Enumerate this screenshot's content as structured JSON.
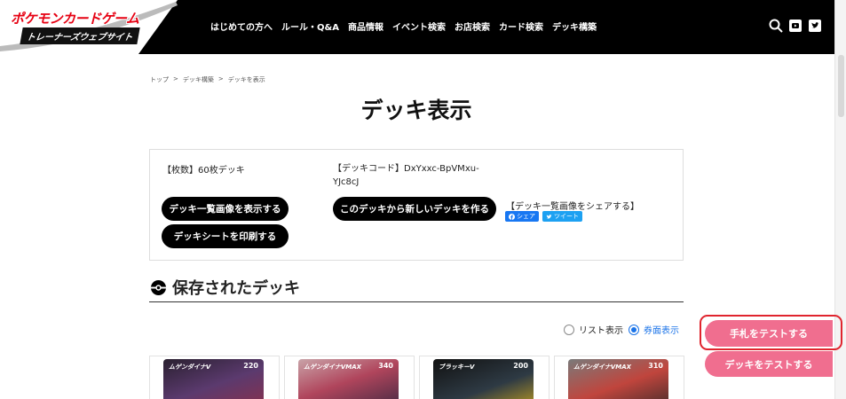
{
  "header": {
    "logo_title": "ポケモンカードゲーム",
    "logo_sub": "トレーナーズウェブサイト",
    "nav": [
      "はじめての方へ",
      "ルール・Q&A",
      "商品情報",
      "イベント検索",
      "お店検索",
      "カード検索",
      "デッキ構築"
    ],
    "icons": [
      "search-icon",
      "youtube-icon",
      "twitter-icon"
    ]
  },
  "breadcrumb": [
    "トップ",
    ">",
    "デッキ構築",
    ">",
    "デッキを表示"
  ],
  "page_title": "デッキ表示",
  "info": {
    "count": "【枚数】60枚デッキ",
    "code": "【デッキコード】DxYxxc-BpVMxu-YJc8cJ",
    "show_image_button": "デッキ一覧画像を表示する",
    "print_button": "デッキシートを印刷する",
    "new_deck_button": "このデッキから新しいデッキを作る",
    "share_label": "【デッキ一覧画像をシェアする】",
    "share_facebook": "シェア",
    "share_twitter": "ツイート"
  },
  "saved": {
    "title": "保存されたデッキ",
    "view_list": "リスト表示",
    "view_card": "券面表示",
    "selected_view": "card"
  },
  "cards": [
    {
      "name": "ムゲンダイナV",
      "hp": "220",
      "color": "#5b3a6e"
    },
    {
      "name": "ムゲンダイナVMAX",
      "hp": "340",
      "color": "#b0455c"
    },
    {
      "name": "ブラッキーV",
      "hp": "200",
      "color": "#2e3a44"
    },
    {
      "name": "ムゲンダイナVMAX",
      "hp": "310",
      "color": "#c0453d"
    }
  ],
  "floating": {
    "test_hand": "手札をテストする",
    "test_deck": "デッキをテストする"
  },
  "colors": {
    "header_bg": "#000000",
    "logo_red": "#e60012",
    "pink": "#f06e8f",
    "highlight_red": "#e0242e",
    "link_blue": "#1a73e8"
  }
}
